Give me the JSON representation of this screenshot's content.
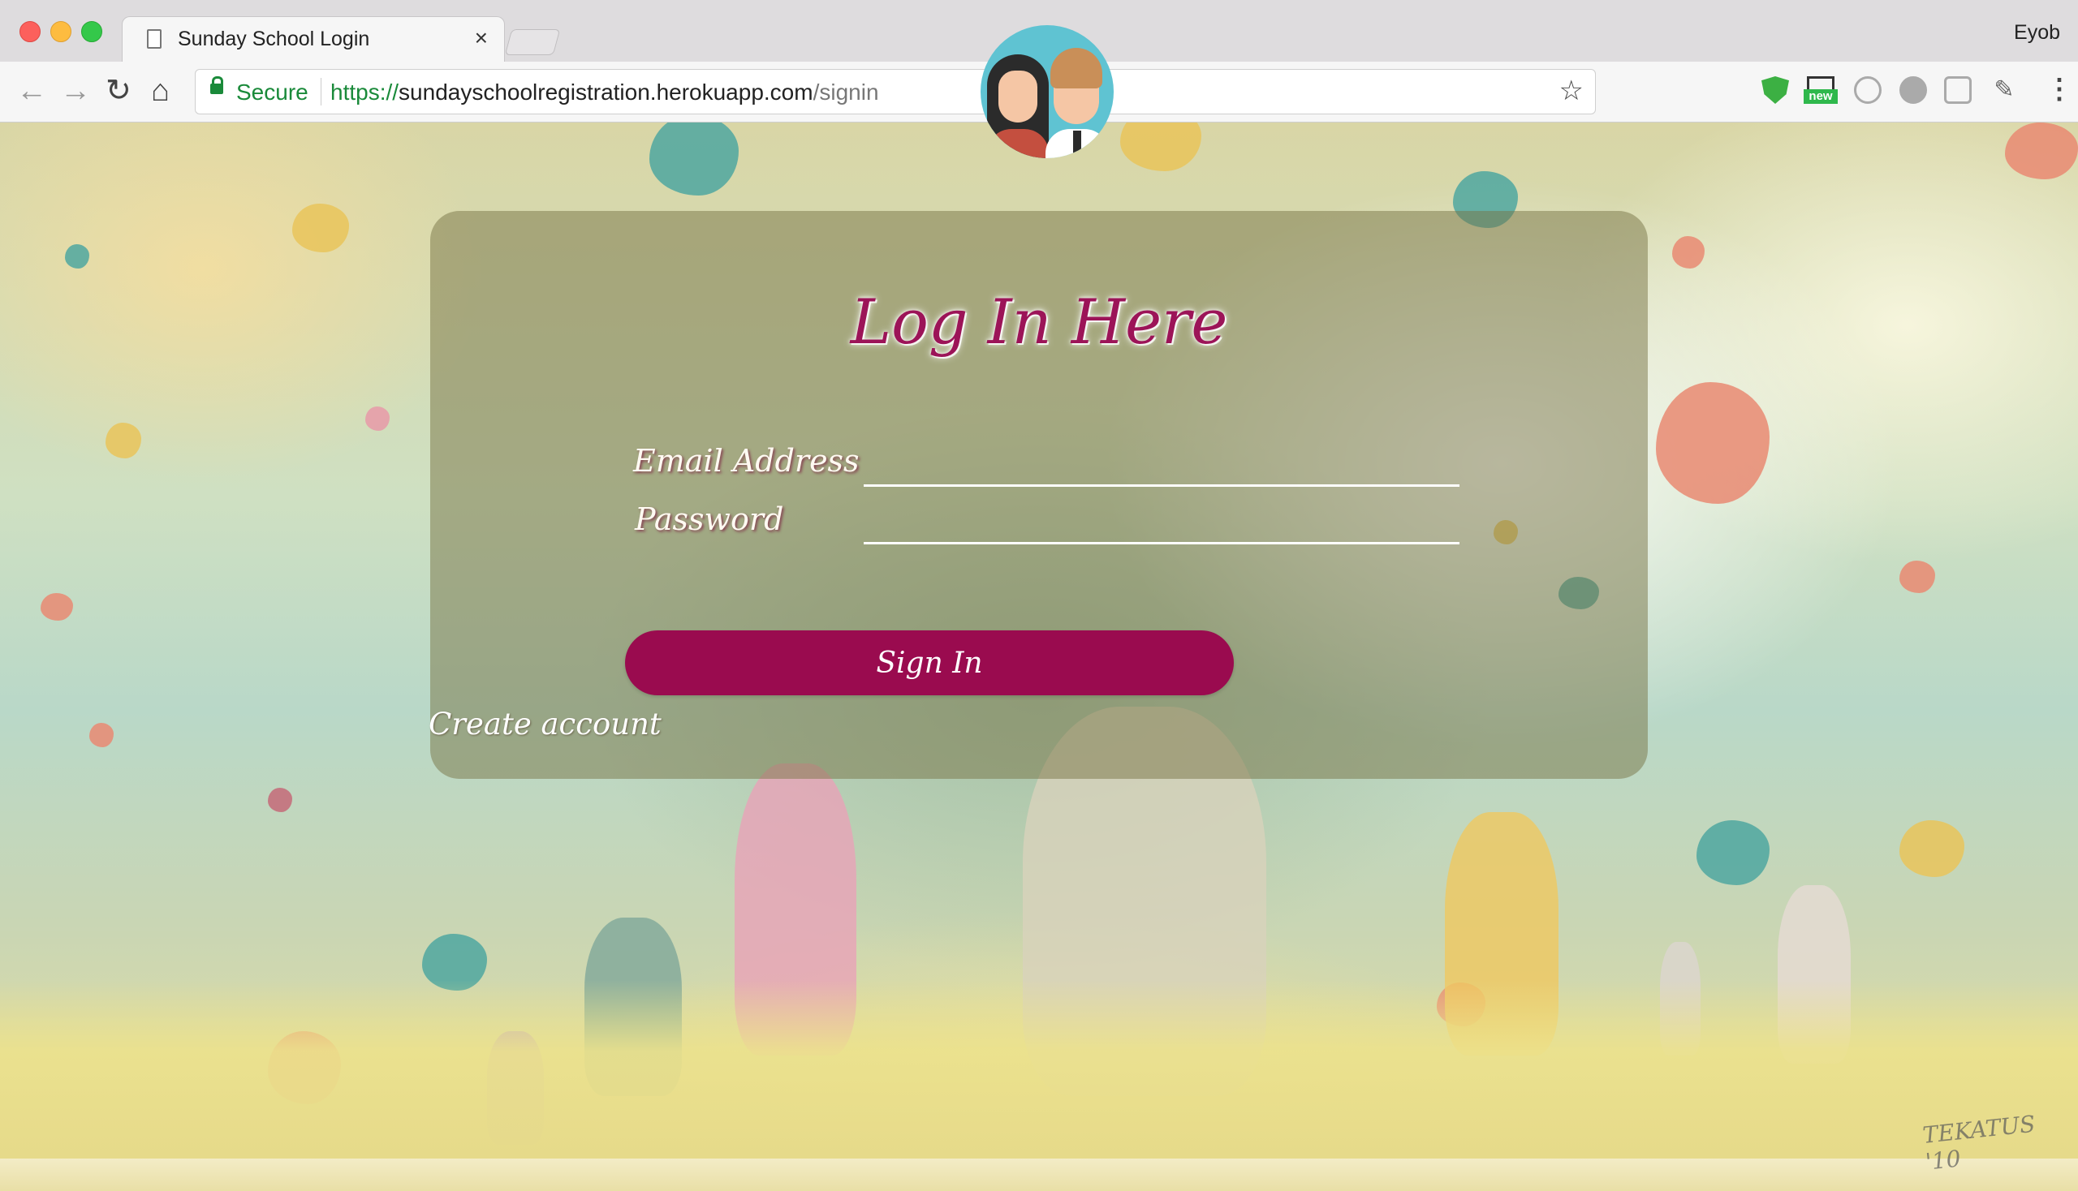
{
  "browser": {
    "tab_title": "Sunday School Login",
    "tab_close": "×",
    "profile_name": "Eyob",
    "nav": {
      "back": "←",
      "forward": "→",
      "reload": "↻",
      "home": "⌂"
    },
    "secure_label": "Secure",
    "url": {
      "protocol": "https://",
      "host": "sundayschoolregistration.herokuapp.com",
      "path": "/signin"
    },
    "bookmark_icon": "☆",
    "extensions": [
      "shield-icon",
      "new-badge-icon",
      "circle-icon",
      "e-icon",
      "gear-icon",
      "eyedropper-icon"
    ],
    "extension_badge": "new",
    "menu_icon": "⋮"
  },
  "login": {
    "title": "Log In Here",
    "email_label": "Email Address",
    "email_value": "",
    "password_label": "Password",
    "password_value": "",
    "submit_label": "Sign In",
    "create_account_label": "Create account"
  },
  "artwork": {
    "signature": "TEKATUS '10"
  },
  "colors": {
    "accent": "#9a0b4f",
    "title": "#9c1458",
    "secure": "#1a8a3a"
  }
}
